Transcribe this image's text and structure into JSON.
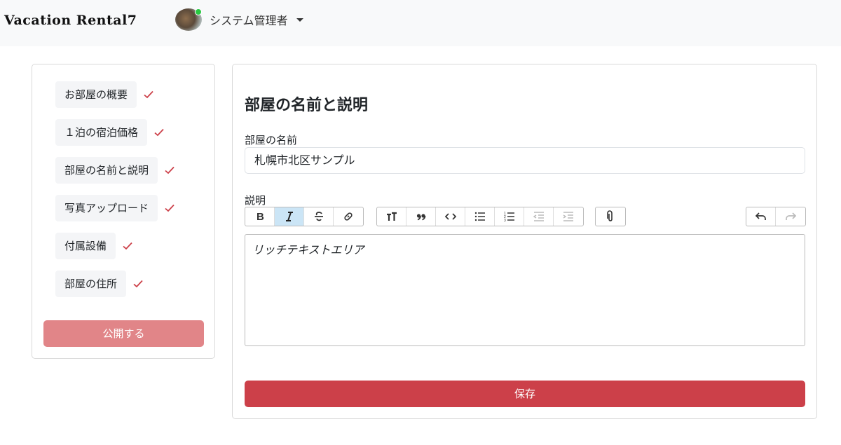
{
  "header": {
    "brand": "Vacation Rental7",
    "user_name": "システム管理者"
  },
  "sidebar": {
    "steps": [
      {
        "label": "お部屋の概要",
        "done": true
      },
      {
        "label": "１泊の宿泊価格",
        "done": true
      },
      {
        "label": "部屋の名前と説明",
        "done": true
      },
      {
        "label": "写真アップロード",
        "done": true
      },
      {
        "label": "付属設備",
        "done": true
      },
      {
        "label": "部屋の住所",
        "done": true
      }
    ],
    "publish_label": "公開する"
  },
  "main": {
    "title": "部屋の名前と説明",
    "name_label": "部屋の名前",
    "name_value": "札幌市北区サンプル",
    "description_label": "説明",
    "editor_text": "リッチテキストエリア",
    "save_label": "保存"
  },
  "toolbar": {
    "groups": [
      [
        "bold-icon",
        "italic-icon",
        "strikethrough-icon",
        "link-icon"
      ],
      [
        "heading-icon",
        "quote-icon",
        "code-icon",
        "bullet-list-icon",
        "numbered-list-icon",
        "outdent-icon",
        "indent-icon"
      ],
      [
        "attach-icon"
      ],
      [
        "undo-icon",
        "redo-icon"
      ]
    ],
    "active": "italic-icon"
  },
  "colors": {
    "accent": "#cc4049",
    "publish_disabled": "#e18588",
    "check": "#cc4049",
    "toolbar_active": "#cbe5f6",
    "online_dot": "#28c840"
  }
}
